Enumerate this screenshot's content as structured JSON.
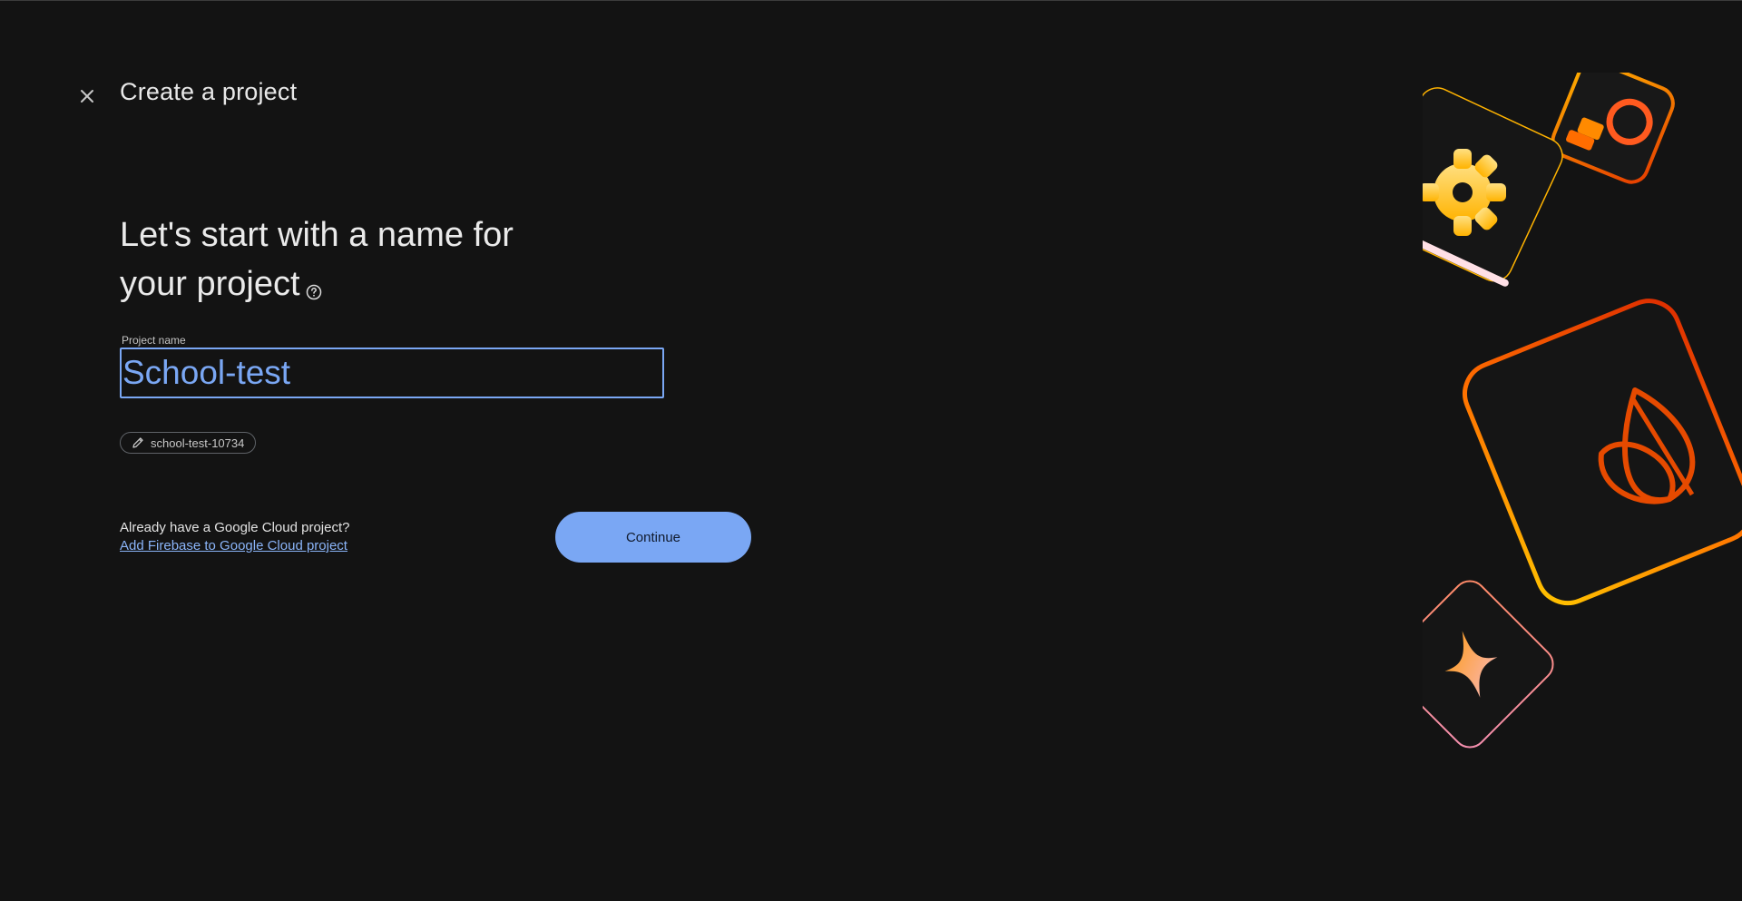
{
  "header": {
    "title": "Create a project",
    "close_icon": "close-icon"
  },
  "main": {
    "headline_line1": "Let's start with a name for",
    "headline_line2": "your project",
    "help_icon": "help-circle-icon",
    "project_name_label": "Project name",
    "project_name_value": "School-test",
    "project_id_chip": "school-test-10734",
    "chip_icon": "pencil-icon"
  },
  "footer": {
    "already_text": "Already have a Google Cloud project?",
    "link_text": "Add Firebase to Google Cloud project",
    "continue_label": "Continue"
  },
  "colors": {
    "background": "#131313",
    "accent": "#7aa7f4",
    "link": "#8ab4f8"
  }
}
